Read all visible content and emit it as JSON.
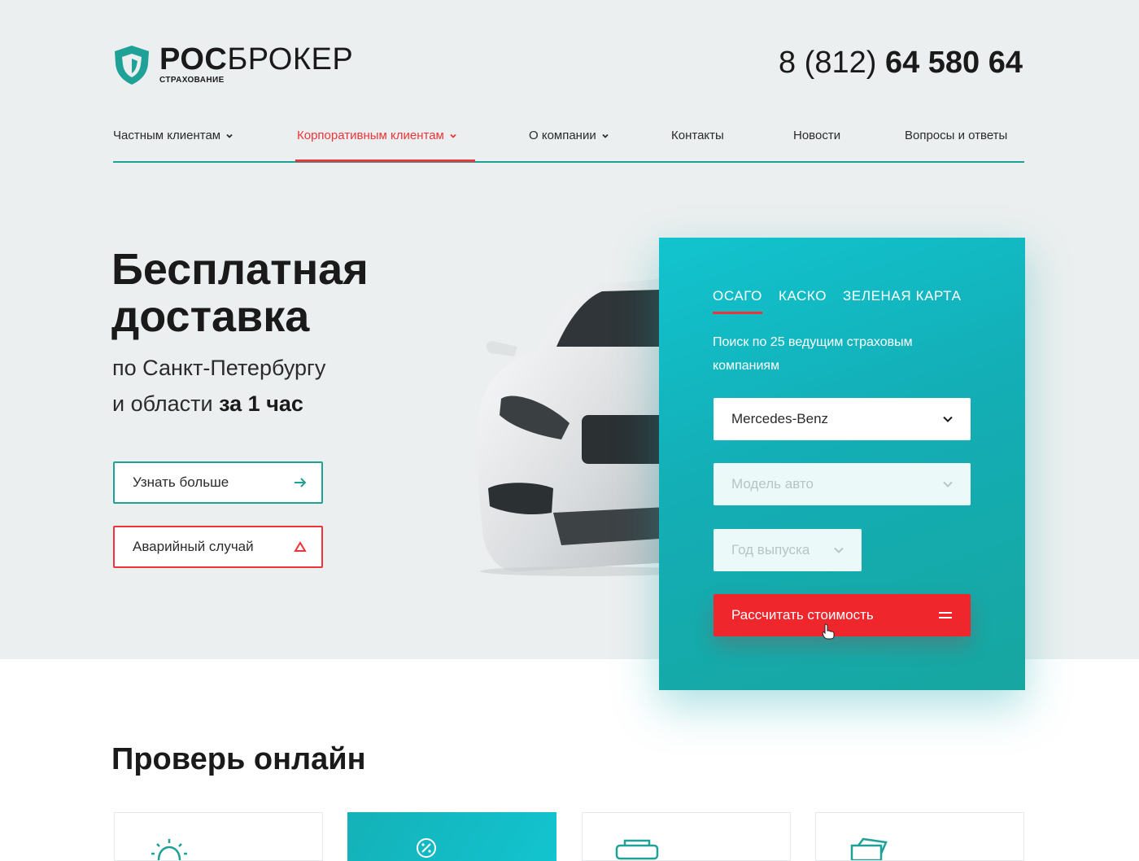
{
  "logo": {
    "brand_bold": "РОС",
    "brand_light": "БРОКЕР",
    "tagline": "СТРАХОВАНИЕ"
  },
  "phone": {
    "prefix": "8 (812)",
    "number": "64 580 64"
  },
  "nav": {
    "items": [
      {
        "label": "Частным клиентам",
        "dropdown": true,
        "active": false
      },
      {
        "label": "Корпоративным клиентам",
        "dropdown": true,
        "active": true
      },
      {
        "label": "О компании",
        "dropdown": true,
        "active": false
      },
      {
        "label": "Контакты",
        "dropdown": false,
        "active": false
      },
      {
        "label": "Новости",
        "dropdown": false,
        "active": false
      },
      {
        "label": "Вопросы и ответы",
        "dropdown": false,
        "active": false
      }
    ]
  },
  "hero": {
    "title_line1": "Бесплатная",
    "title_line2": "доставка",
    "subtitle_line1": "по Санкт-Петербургу",
    "subtitle_line2_prefix": "и области",
    "subtitle_line2_bold": "за 1 час",
    "more_button": "Узнать больше",
    "accident_button": "Аварийный случай"
  },
  "calculator": {
    "tabs": [
      "ОСАГО",
      "КАСКО",
      "ЗЕЛЕНАЯ КАРТА"
    ],
    "active_tab": "ОСАГО",
    "description": "Поиск по 25 ведущим страховым компаниям",
    "brand_value": "Mercedes-Benz",
    "model_placeholder": "Модель авто",
    "year_placeholder": "Год выпуска",
    "submit_label": "Рассчитать стоимость"
  },
  "section_check": {
    "title": "Проверь онлайн"
  },
  "colors": {
    "teal": "#1fa197",
    "red": "#ef3339",
    "calc_bg": "#13aeb6",
    "hero_bg": "#ebefef"
  },
  "icons": [
    "shield-logo-icon",
    "chevron-down-icon",
    "arrow-right-icon",
    "warning-triangle-icon",
    "menu-lines-icon",
    "cursor-hand-icon"
  ]
}
